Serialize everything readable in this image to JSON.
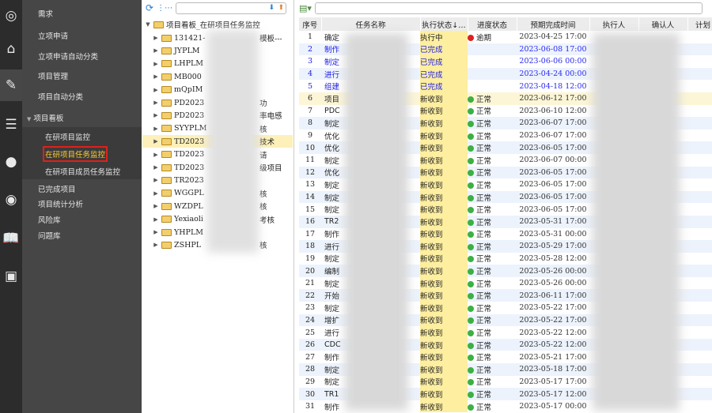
{
  "rail": [
    "sipm-logo-icon",
    "home-icon",
    "edit-icon",
    "database-icon",
    "chat-icon",
    "broadcast-icon",
    "book-icon",
    "id-card-icon"
  ],
  "menu": {
    "items": [
      "需求",
      "立项申请",
      "立项申请自动分类",
      "项目管理",
      "项目自动分类"
    ],
    "group": "项目看板",
    "sub": [
      "在研项目监控",
      "在研项目任务监控",
      "在研项目成员任务监控"
    ],
    "after": [
      "已完成项目",
      "项目统计分析",
      "风险库",
      "问题库"
    ]
  },
  "tree": {
    "root": "项目看板_在研项目任务监控",
    "nodes": [
      {
        "a": "131421-",
        "b": "模板---"
      },
      {
        "a": "JYPLM",
        "b": ""
      },
      {
        "a": "LHPLM",
        "b": ""
      },
      {
        "a": "MB000",
        "b": ""
      },
      {
        "a": "mQpIM",
        "b": ""
      },
      {
        "a": "PD2023",
        "b": "功"
      },
      {
        "a": "PD2023",
        "b": "率电感"
      },
      {
        "a": "SYYPLM",
        "b": "核"
      },
      {
        "a": "TD2023",
        "b": "技术"
      },
      {
        "a": "TD2023",
        "b": "请"
      },
      {
        "a": "TD2023",
        "b": "级项目"
      },
      {
        "a": "TR2023",
        "b": ""
      },
      {
        "a": "WGGPL",
        "b": "核"
      },
      {
        "a": "WZDPL",
        "b": "核"
      },
      {
        "a": "Yexiaoli",
        "b": "考核"
      },
      {
        "a": "YHPLM",
        "b": ""
      },
      {
        "a": "ZSHPL",
        "b": "核"
      }
    ]
  },
  "grid": {
    "columns": [
      "序号",
      "任务名称",
      "执行状态↓…",
      "进度状态",
      "预期完成时间",
      "执行人",
      "确认人",
      "计划"
    ],
    "colors": {
      "ok": "#3cb043",
      "late": "#e02020"
    },
    "rows": [
      [
        "1",
        "确定",
        "执行中",
        "逾期",
        "2023-04-25 17:00"
      ],
      [
        "2",
        "制作",
        "已完成",
        "",
        "2023-06-08 17:00"
      ],
      [
        "3",
        "制定",
        "已完成",
        "",
        "2023-06-06 00:00"
      ],
      [
        "4",
        "进行",
        "已完成",
        "",
        "2023-04-24 00:00"
      ],
      [
        "5",
        "组建",
        "已完成",
        "",
        "2023-04-18 12:00"
      ],
      [
        "6",
        "项目",
        "新收到",
        "正常",
        "2023-06-12 17:00"
      ],
      [
        "7",
        "PDC",
        "新收到",
        "正常",
        "2023-06-10 12:00"
      ],
      [
        "8",
        "制定",
        "新收到",
        "正常",
        "2023-06-07 17:00"
      ],
      [
        "9",
        "优化",
        "新收到",
        "正常",
        "2023-06-07 17:00"
      ],
      [
        "10",
        "优化",
        "新收到",
        "正常",
        "2023-06-05 17:00"
      ],
      [
        "11",
        "制定",
        "新收到",
        "正常",
        "2023-06-07 00:00"
      ],
      [
        "12",
        "优化",
        "新收到",
        "正常",
        "2023-06-05 17:00"
      ],
      [
        "13",
        "制定",
        "新收到",
        "正常",
        "2023-06-05 17:00"
      ],
      [
        "14",
        "制定",
        "新收到",
        "正常",
        "2023-06-05 17:00"
      ],
      [
        "15",
        "制定",
        "新收到",
        "正常",
        "2023-06-05 17:00"
      ],
      [
        "16",
        "TR2",
        "新收到",
        "正常",
        "2023-05-31 17:00"
      ],
      [
        "17",
        "制作",
        "新收到",
        "正常",
        "2023-05-31 00:00"
      ],
      [
        "18",
        "进行",
        "新收到",
        "正常",
        "2023-05-29 17:00"
      ],
      [
        "19",
        "制定",
        "新收到",
        "正常",
        "2023-05-28 12:00"
      ],
      [
        "20",
        "编制",
        "新收到",
        "正常",
        "2023-05-26 00:00"
      ],
      [
        "21",
        "制定",
        "新收到",
        "正常",
        "2023-05-26 00:00"
      ],
      [
        "22",
        "开始",
        "新收到",
        "正常",
        "2023-06-11 17:00"
      ],
      [
        "23",
        "制定",
        "新收到",
        "正常",
        "2023-05-22 17:00"
      ],
      [
        "24",
        "增扩",
        "新收到",
        "正常",
        "2023-05-22 17:00"
      ],
      [
        "25",
        "进行",
        "新收到",
        "正常",
        "2023-05-22 12:00"
      ],
      [
        "26",
        "CDC",
        "新收到",
        "正常",
        "2023-05-22 12:00"
      ],
      [
        "27",
        "制作",
        "新收到",
        "正常",
        "2023-05-21 17:00"
      ],
      [
        "28",
        "制定",
        "新收到",
        "正常",
        "2023-05-18 17:00"
      ],
      [
        "29",
        "制定",
        "新收到",
        "正常",
        "2023-05-17 17:00"
      ],
      [
        "30",
        "TR1",
        "新收到",
        "正常",
        "2023-05-17 12:00"
      ],
      [
        "31",
        "制作",
        "新收到",
        "正常",
        "2023-05-17 00:00"
      ]
    ]
  }
}
